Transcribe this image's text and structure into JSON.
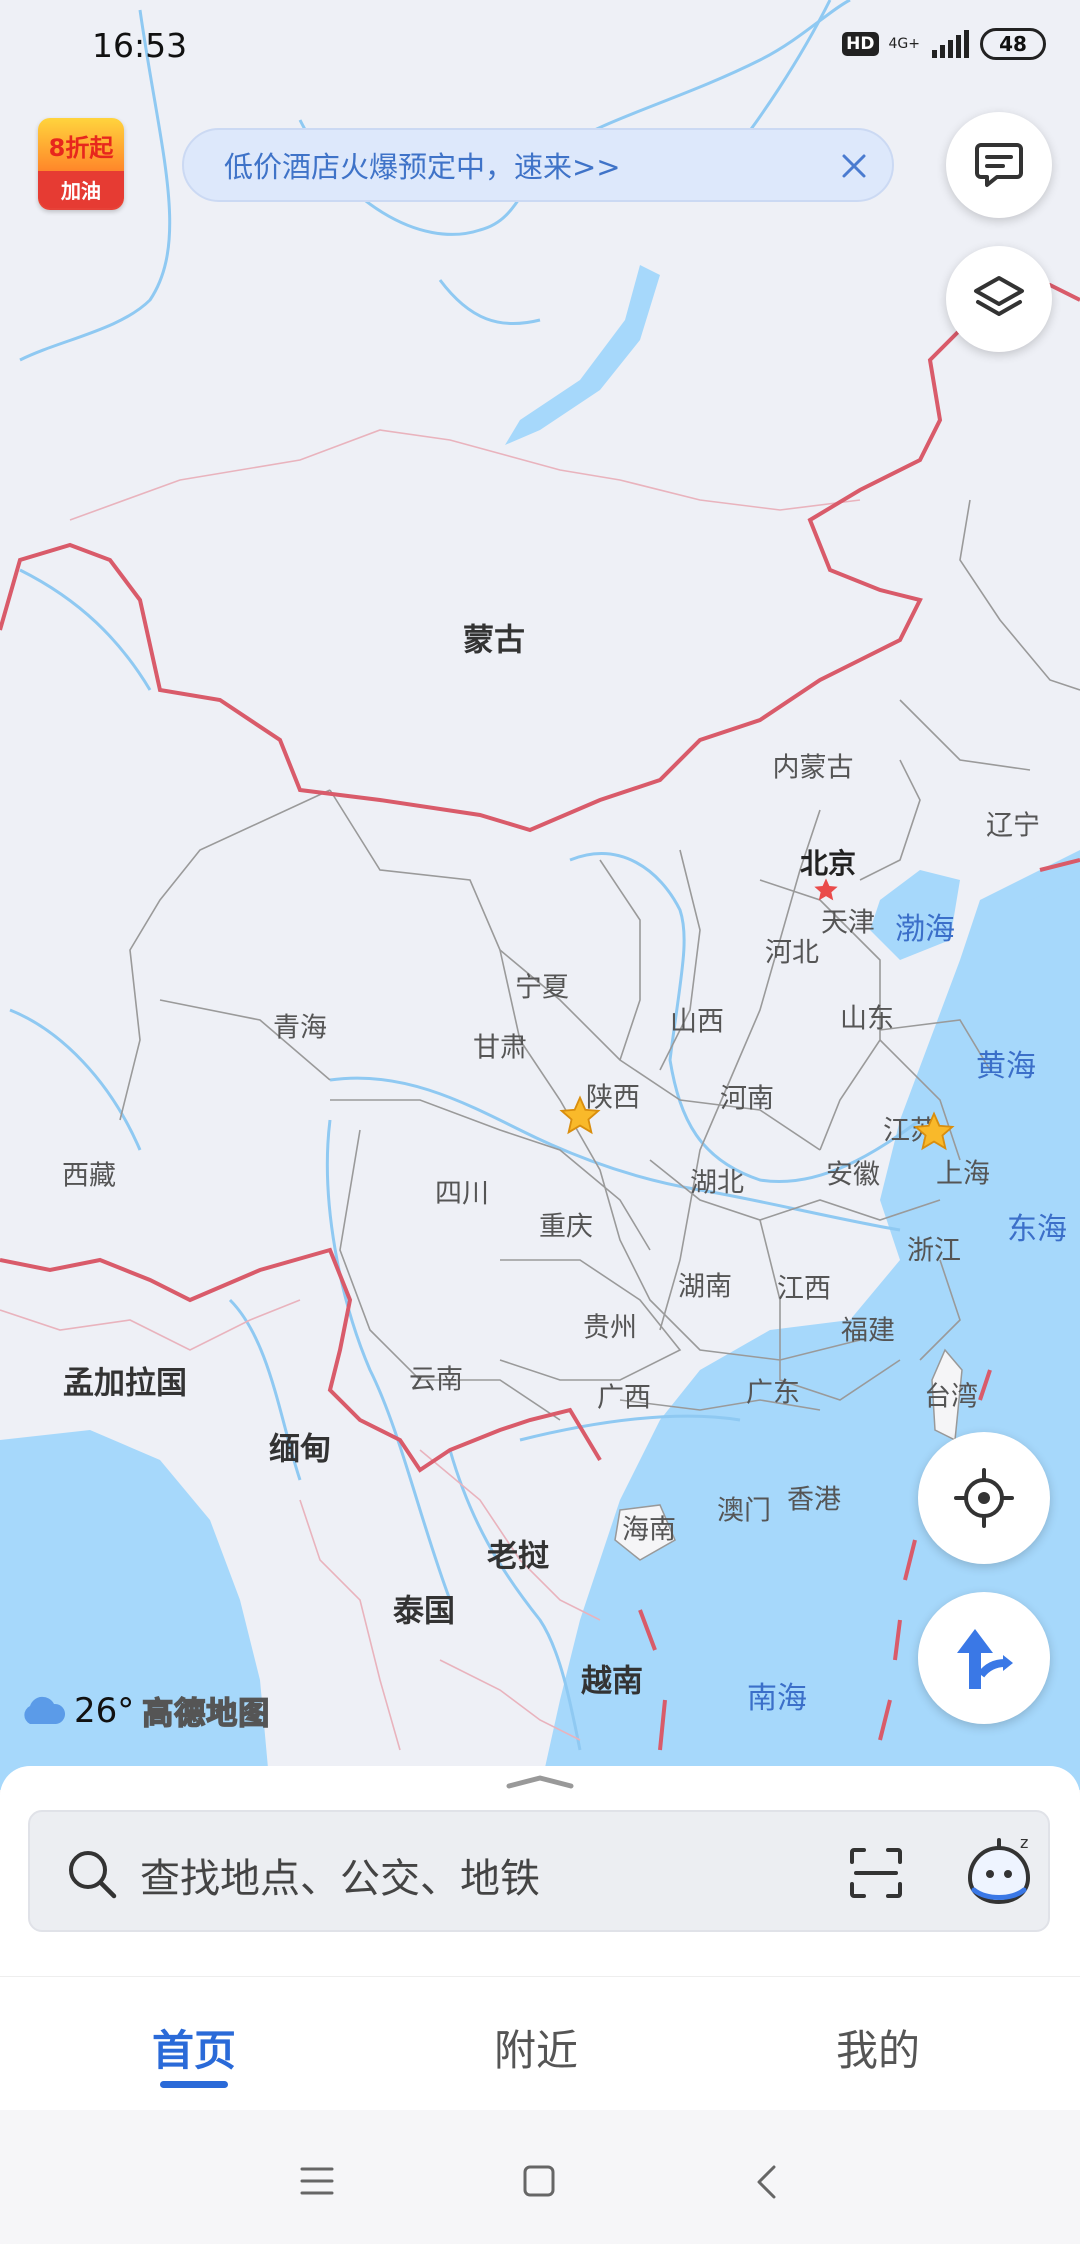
{
  "status_bar": {
    "time": "16:53",
    "hd": "HD",
    "network": "4G+",
    "battery": "48"
  },
  "promo_badge": {
    "discount": "8折起",
    "label": "加油"
  },
  "banner": {
    "text": "低价酒店火爆预定中，速来>>"
  },
  "map": {
    "countries": [
      "蒙古",
      "孟加拉国",
      "缅甸",
      "老挝",
      "泰国",
      "越南"
    ],
    "provinces": [
      "内蒙古",
      "辽宁",
      "北京",
      "天津",
      "河北",
      "山西",
      "山东",
      "宁夏",
      "青海",
      "甘肃",
      "陕西",
      "河南",
      "江苏",
      "上海",
      "安徽",
      "湖北",
      "西藏",
      "四川",
      "重庆",
      "浙江",
      "湖南",
      "江西",
      "贵州",
      "福建",
      "云南",
      "广西",
      "广东",
      "台湾",
      "澳门",
      "香港",
      "海南"
    ],
    "seas": [
      "渤海",
      "黄海",
      "东海",
      "南海"
    ]
  },
  "weather": {
    "temp": "26°",
    "brand": "高德地图"
  },
  "search": {
    "placeholder": "查找地点、公交、地铁"
  },
  "tabs": [
    {
      "label": "首页",
      "active": true
    },
    {
      "label": "附近"
    },
    {
      "label": "我的"
    }
  ],
  "colors": {
    "accent": "#2a6ad8",
    "border": "#d9576b",
    "water": "#a6d8fb"
  }
}
